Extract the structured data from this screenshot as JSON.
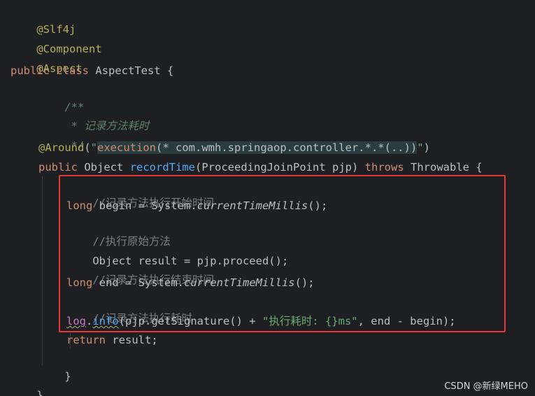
{
  "code": {
    "l1": "@Slf4j",
    "l2": "@Component",
    "l3": "@Aspect",
    "l4_kw1": "public",
    "l4_kw2": "class",
    "l4_name": "AspectTest {",
    "l5": "/**",
    "l6": " * 记录方法耗时",
    "l7": " */",
    "l8_ann": "@Around",
    "l8_paren_open": "(",
    "l8_quote_open": "\"",
    "l8_fn": "execution",
    "l8_expr": "(* com.wmh.springaop.controller.*.*(..))",
    "l8_quote_close": "\"",
    "l8_paren_close": ")",
    "l9_kw": "public",
    "l9_type": "Object",
    "l9_method": "recordTime",
    "l9_params": "(ProceedingJoinPoint pjp)",
    "l9_throws": "throws",
    "l9_rest": "Throwable {",
    "l10": "//记录方法执行开始时间",
    "l11_kw": "long",
    "l11_a": "begin = System.",
    "l11_call": "currentTimeMillis",
    "l11_b": "();",
    "l12": "//执行原始方法",
    "l13": "Object result = pjp.proceed();",
    "l14": "//记录方法执行结束时间",
    "l15_kw": "long",
    "l15_a": "end = System.",
    "l15_call": "currentTimeMillis",
    "l15_b": "();",
    "l16": "//记录方法执行耗时",
    "l17_field": "log",
    "l17_dot": ".",
    "l17_method": "info",
    "l17_a": "(pjp.getSignature() + ",
    "l17_str": "\"执行耗时: {}ms\"",
    "l17_b": ", end - begin);",
    "l18_kw": "return",
    "l18_rest": "result;",
    "l19": "}",
    "l20": "}"
  },
  "watermark": "CSDN @新绿MEHO",
  "colors": {
    "background": "#1e1f22",
    "keyword": "#cf8e6d",
    "annotation": "#b3ae60",
    "string": "#6aab73",
    "method": "#56a8f5",
    "comment": "#7a7e85",
    "highlight_box": "#e5383b"
  }
}
